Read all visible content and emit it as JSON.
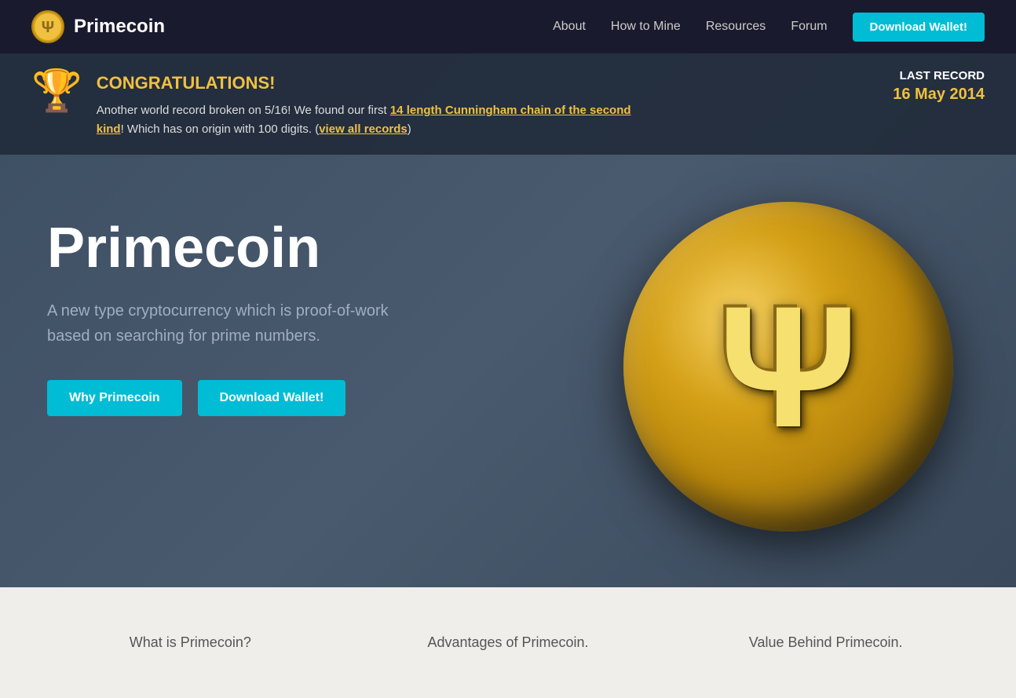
{
  "navbar": {
    "brand_name": "Primecoin",
    "links": [
      {
        "label": "About",
        "id": "about"
      },
      {
        "label": "How to Mine",
        "id": "how-to-mine"
      },
      {
        "label": "Resources",
        "id": "resources"
      },
      {
        "label": "Forum",
        "id": "forum"
      }
    ],
    "download_button": "Download Wallet!"
  },
  "congrats": {
    "title": "CONGRATULATIONS!",
    "text_prefix": "Another world record broken on 5/16! We found our first ",
    "link_text": "14 length Cunningham chain of the second kind",
    "text_suffix": "! Which has on origin with 100 digits. (",
    "view_records_text": "view all records",
    "text_close": ")",
    "last_record_label": "LAST RECORD",
    "last_record_date": "16 May 2014"
  },
  "hero": {
    "title": "Primecoin",
    "subtitle": "A new type cryptocurrency which is proof-of-work based on searching for prime numbers.",
    "btn_why": "Why Primecoin",
    "btn_download": "Download Wallet!"
  },
  "coin": {
    "symbol": "Ψ"
  },
  "footer_cols": [
    {
      "title": "What is Primecoin?"
    },
    {
      "title": "Advantages of Primecoin."
    },
    {
      "title": "Value Behind Primecoin."
    }
  ]
}
